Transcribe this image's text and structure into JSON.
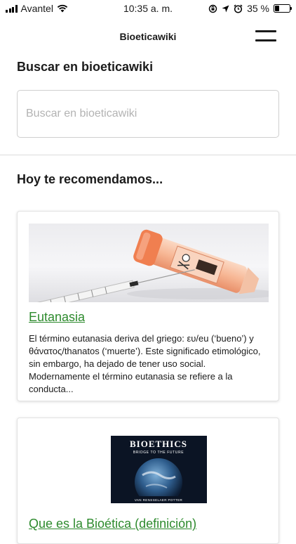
{
  "status_bar": {
    "carrier": "Avantel",
    "time": "10:35 a. m.",
    "battery": "35 %"
  },
  "nav": {
    "title": "Bioeticawiki"
  },
  "search": {
    "heading": "Buscar en bioeticawiki",
    "placeholder": "Buscar en bioeticawiki"
  },
  "recommend": {
    "heading": "Hoy te recomendamos..."
  },
  "cards": [
    {
      "title": "Eutanasia",
      "image_label": "Toxic",
      "excerpt": "El término eutanasia deriva del griego: ευ/eu (‘bueno’) y θάνατος/thanatos (‘muerte’). Este significado etimológico, sin embargo, ha dejado de tener uso social. Modernamente el término eutanasia se refiere a la conducta..."
    },
    {
      "title": "Que es la Bioética (definición)",
      "book_title": "BIOETHICS",
      "book_subtitle": "BRIDGE TO THE FUTURE",
      "book_author": "VAN RENSSELAER POTTER"
    }
  ],
  "colors": {
    "link_green": "#2d8a2d",
    "text": "#1b1b1b",
    "syringe_cap": "#f28a5a"
  }
}
